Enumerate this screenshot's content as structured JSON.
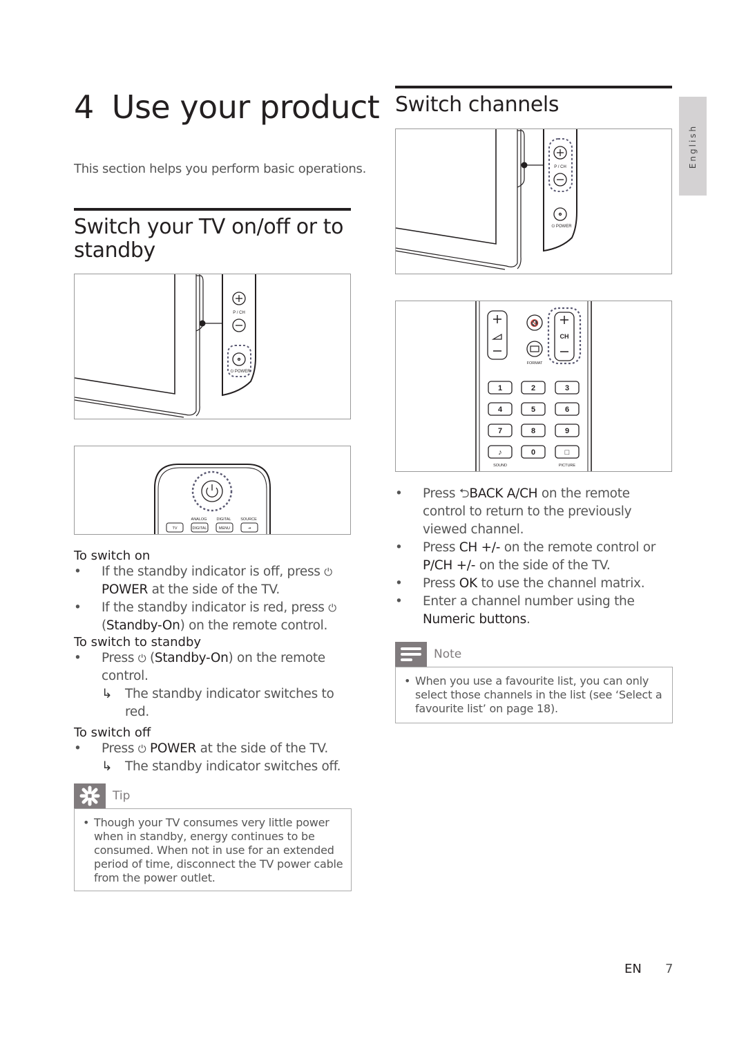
{
  "chapter": {
    "number": "4",
    "title": "Use your product",
    "intro": "This section helps you perform basic operations."
  },
  "language_tab": "English",
  "section1": {
    "title": "Switch your TV on/off or to standby",
    "figure_tv": {
      "panel_label_pch": "P / CH",
      "panel_label_power": "POWER"
    },
    "figure_remote": {
      "buttons": [
        "TV",
        "DIGITAL",
        "MENU",
        "SOURCE"
      ],
      "labels_top": [
        "ANALOG",
        "DIGITAL",
        "SOURCE"
      ]
    },
    "switch_on": {
      "heading": "To switch on",
      "items": [
        {
          "pre": "If the standby indicator is off, press",
          "icon": "power-icon",
          "bold": "POWER",
          "post": "at the side of the TV."
        },
        {
          "pre": "If the standby indicator is red, press",
          "icon": "power-icon",
          "open": "(",
          "bold": "Standby-On",
          "post": ") on the remote control."
        }
      ]
    },
    "switch_standby": {
      "heading": "To switch to standby",
      "items": [
        {
          "pre": "Press",
          "icon": "power-icon",
          "open": "(",
          "bold": "Standby-On",
          "post": ") on the remote control.",
          "result": "The standby indicator switches to red."
        }
      ]
    },
    "switch_off": {
      "heading": "To switch off",
      "items": [
        {
          "pre": "Press",
          "icon": "power-icon",
          "bold": "POWER",
          "post": "at the side of the TV.",
          "result": "The standby indicator switches off."
        }
      ]
    },
    "tip": {
      "label": "Tip",
      "text": "Though your TV consumes very little power when in standby, energy continues to be consumed. When not in use for an extended period of time, disconnect the TV power cable from the power outlet."
    }
  },
  "section2": {
    "title": "Switch channels",
    "figure_tv": {
      "panel_label_pch": "P / CH",
      "panel_label_power": "POWER"
    },
    "figure_remote": {
      "ch_label": "CH",
      "format_label": "FORMAT",
      "numeric": [
        "1",
        "2",
        "3",
        "4",
        "5",
        "6",
        "7",
        "8",
        "9",
        "♪",
        "0",
        "□"
      ],
      "sound_label": "SOUND",
      "picture_label": "PICTURE"
    },
    "items": [
      {
        "pre": "Press",
        "icon": "back-icon",
        "bold": "BACK A/CH",
        "post": "on the remote control to return to the previously viewed channel."
      },
      {
        "pre": "Press",
        "bold": "CH +/-",
        "post": "on the remote control or",
        "bold2": "P/CH +/-",
        "post2": "on the side of the TV."
      },
      {
        "pre": "Press",
        "bold": "OK",
        "post": "to use the channel matrix."
      },
      {
        "pre": "Enter a channel number using the",
        "bold": "Numeric buttons",
        "post": "."
      }
    ],
    "note": {
      "label": "Note",
      "text": "When you use a favourite list, you can only select those channels in the list (see ‘Select a favourite list’ on page 18)."
    }
  },
  "footer": {
    "lang": "EN",
    "page": "7"
  },
  "glyphs": {
    "bullet": "•",
    "result_arrow": "↳",
    "power": "⏻"
  },
  "colors": {
    "text": "#231f20",
    "body": "#555555",
    "callout": "#807b7d",
    "dashed": "#5b5a73"
  }
}
